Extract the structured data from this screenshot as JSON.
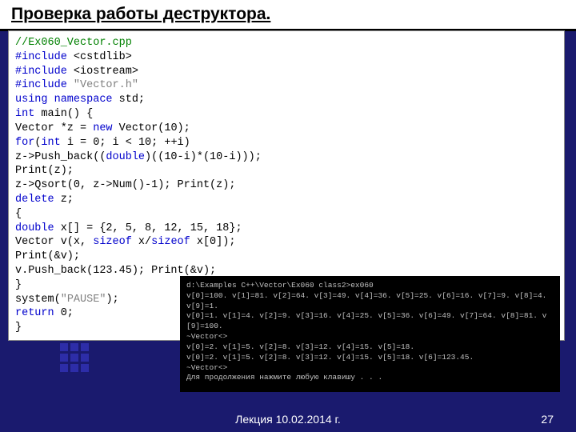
{
  "header": {
    "title": "Проверка работы деструктора."
  },
  "code": {
    "l1": "//Ex060_Vector.cpp",
    "l2a": "#include",
    "l2b": " <cstdlib>",
    "l3a": "#include",
    "l3b": " <iostream>",
    "l4a": "#include",
    "l4b": " \"Vector.h\"",
    "l5a": "using namespace",
    "l5b": " std;",
    "l6a": "int",
    "l6b": " main() {",
    "l7a": "  Vector *z = ",
    "l7b": "new",
    "l7c": " Vector(10);",
    "l8a": "  for",
    "l8b": "(",
    "l8c": "int",
    "l8d": " i = 0; i < 10; ++i)",
    "l9a": "    z->Push_back((",
    "l9b": "double",
    "l9c": ")((10-i)*(10-i)));",
    "l10": "  Print(z);",
    "l11": "  z->Qsort(0, z->Num()-1); Print(z);",
    "l12a": "  delete",
    "l12b": " z;",
    "l13": "  {",
    "l14a": "   double",
    "l14b": " x[] = {2, 5, 8, 12, 15, 18};",
    "l15a": "   Vector v(x, ",
    "l15b": "sizeof",
    "l15c": " x/",
    "l15d": "sizeof",
    "l15e": " x[0]);",
    "l16": "   Print(&v);",
    "l17": "   v.Push_back(123.45); Print(&v);",
    "l18": "  }",
    "l19a": "  system(",
    "l19b": "\"PAUSE\"",
    "l19c": ");",
    "l20a": "  return",
    "l20b": " 0;",
    "l21": "}"
  },
  "terminal": {
    "t1": "d:\\Examples C++\\Vector\\Ex060 class2>ex060",
    "t2": "v[0]=100. v[1]=81. v[2]=64. v[3]=49. v[4]=36. v[5]=25. v[6]=16. v[7]=9. v[8]=4. v[9]=1.",
    "t3": "v[0]=1. v[1]=4. v[2]=9. v[3]=16. v[4]=25. v[5]=36. v[6]=49. v[7]=64. v[8]=81. v[9]=100.",
    "t4": "~Vector<>",
    "t5": "v[0]=2. v[1]=5. v[2]=8. v[3]=12. v[4]=15. v[5]=18.",
    "t6": "v[0]=2. v[1]=5. v[2]=8. v[3]=12. v[4]=15. v[5]=18. v[6]=123.45.",
    "t7": "~Vector<>",
    "t8": "Для продолжения нажмите любую клавишу . . ."
  },
  "footer": {
    "lecture": "Лекция 10.02.2014 г.",
    "page": "27"
  }
}
